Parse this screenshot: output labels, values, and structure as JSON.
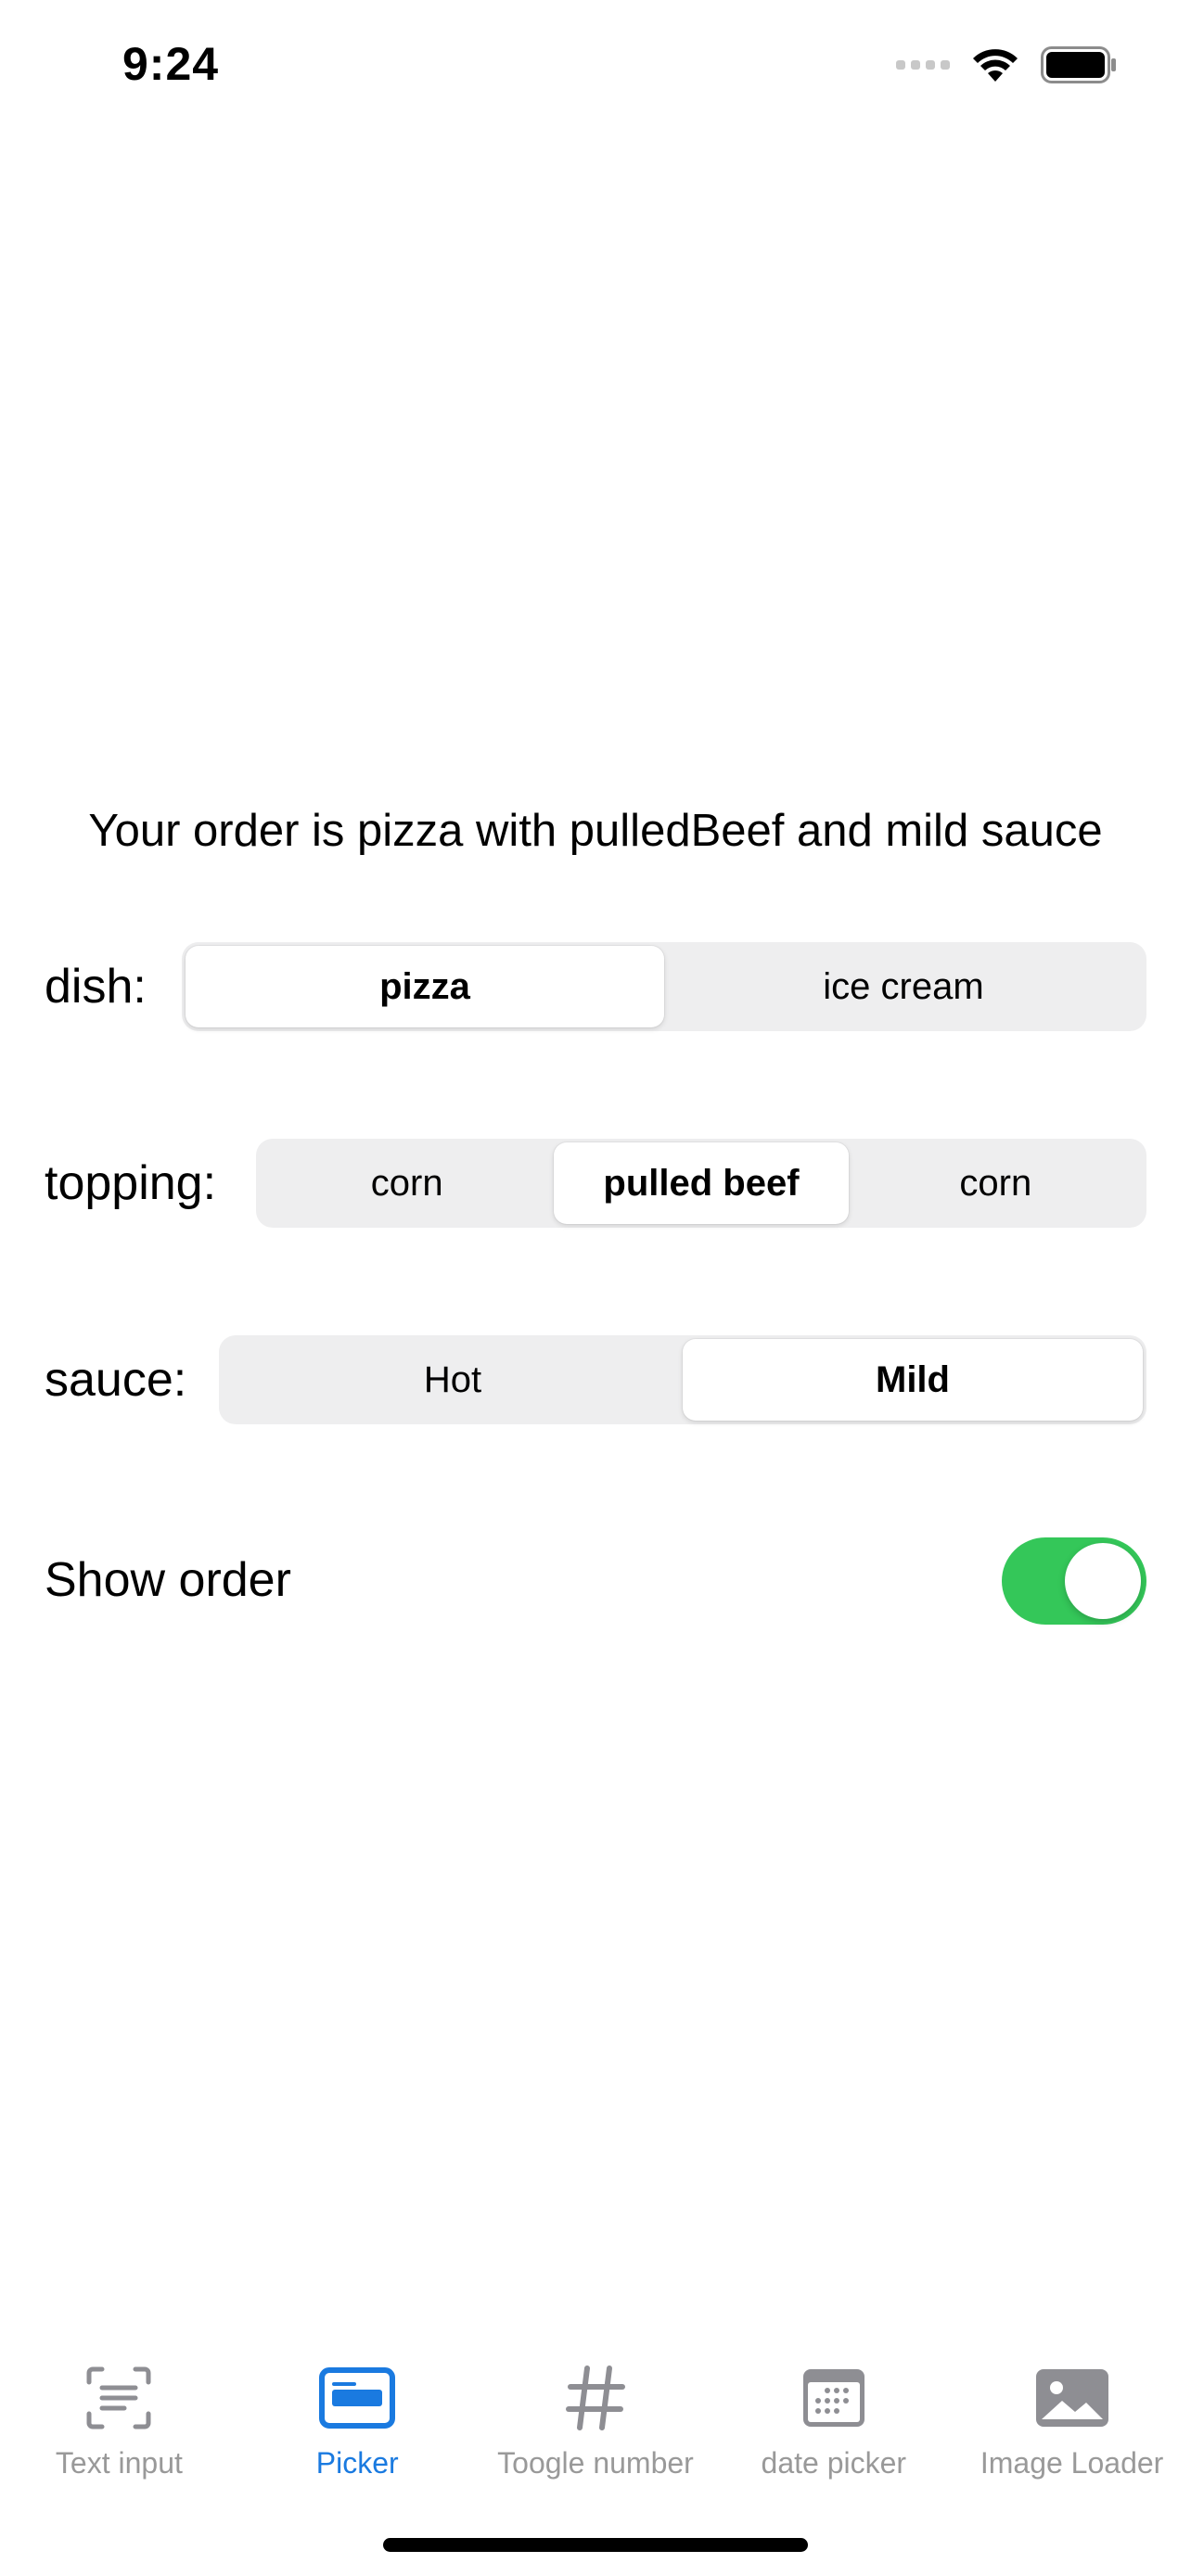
{
  "status_bar": {
    "time": "9:24"
  },
  "summary": "Your order is pizza with pulledBeef and mild sauce",
  "dish": {
    "label": "dish:",
    "options": [
      "pizza",
      "ice cream"
    ],
    "selected": "pizza"
  },
  "topping": {
    "label": "topping:",
    "options": [
      "corn",
      "pulled beef",
      "corn"
    ],
    "selected": "pulled beef"
  },
  "sauce": {
    "label": "sauce:",
    "options": [
      "Hot",
      "Mild"
    ],
    "selected": "Mild"
  },
  "show_order": {
    "label": "Show order",
    "on": true,
    "on_color": "#34c759"
  },
  "tabs": [
    {
      "label": "Text input",
      "icon": "text-scan-icon",
      "active": false
    },
    {
      "label": "Picker",
      "icon": "picker-icon",
      "active": true
    },
    {
      "label": "Toogle number",
      "icon": "number-sign-icon",
      "active": false
    },
    {
      "label": "date picker",
      "icon": "calendar-icon",
      "active": false
    },
    {
      "label": "Image Loader",
      "icon": "photo-icon",
      "active": false
    }
  ],
  "colors": {
    "accent": "#1a7ae0",
    "inactive": "#999999"
  }
}
